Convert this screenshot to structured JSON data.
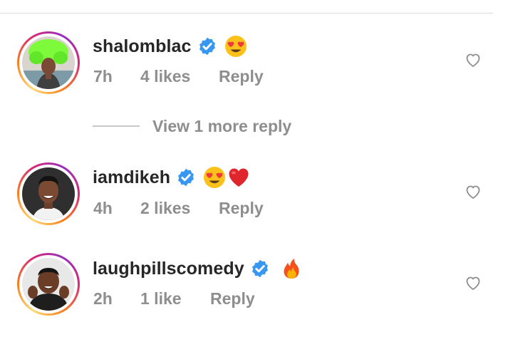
{
  "comments": [
    {
      "username": "shalomblac",
      "time": "7h",
      "likes": "4 likes",
      "reply": "Reply",
      "emojis": [
        "heart-eyes"
      ]
    },
    {
      "username": "iamdikeh",
      "time": "4h",
      "likes": "2 likes",
      "reply": "Reply",
      "emojis": [
        "heart-eyes",
        "red-heart"
      ]
    },
    {
      "username": "laughpillscomedy",
      "time": "2h",
      "likes": "1 like",
      "reply": "Reply",
      "emojis": [
        "fire"
      ]
    }
  ],
  "view_more_replies": "View 1 more reply",
  "colors": {
    "verified": "#3897f0",
    "meta_text": "#8e8e8e",
    "username": "#262626"
  }
}
